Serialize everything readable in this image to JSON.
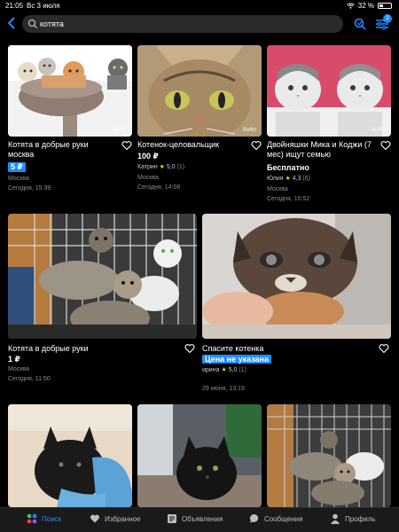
{
  "status_bar": {
    "time": "21:05",
    "date": "Вс 3 июля",
    "battery": "32 %"
  },
  "search": {
    "query": "котята"
  },
  "filter_badge_count": "2",
  "listings": [
    {
      "title": "Котята в добрые руки москва",
      "price": "5 ₽",
      "price_highlight": true,
      "seller": "",
      "rating": "",
      "reviews": "",
      "location": "Москва",
      "date": "Сегодня, 15:39",
      "watermark": "Avito"
    },
    {
      "title": "Котенок-целовальщик",
      "price": "100 ₽",
      "price_highlight": false,
      "seller": "Катрин",
      "rating": "5,0",
      "reviews": "(1)",
      "location": "Москва",
      "date": "Сегодня, 14:08",
      "watermark": "Avito"
    },
    {
      "title": "Двойняшки Мика и Коджи (7 мес) ищут семью",
      "price": "Бесплатно",
      "price_highlight": false,
      "seller": "Юлия",
      "rating": "4,3",
      "reviews": "(6)",
      "location": "Москва",
      "date": "Сегодня, 10:52",
      "watermark": "Avito"
    },
    {
      "title": "Котята в добрые руки",
      "price": "1 ₽",
      "price_highlight": false,
      "seller": "",
      "rating": "",
      "reviews": "",
      "location": "Москва",
      "date": "Сегодня, 11:50",
      "watermark": ""
    },
    {
      "title": "Спасите котенка",
      "price": "Цена не указана",
      "price_highlight": true,
      "seller": "ирина",
      "rating": "5,0",
      "reviews": "(1)",
      "location": "",
      "date": "29 июня, 13:19",
      "watermark": ""
    }
  ],
  "bottom_nav": [
    {
      "label": "Поиск",
      "icon": "search-dots-icon",
      "active": true
    },
    {
      "label": "Избранное",
      "icon": "heart-icon",
      "active": false
    },
    {
      "label": "Объявления",
      "icon": "listings-icon",
      "active": false
    },
    {
      "label": "Сообщения",
      "icon": "chat-icon",
      "active": false
    },
    {
      "label": "Профиль",
      "icon": "profile-icon",
      "active": false
    }
  ],
  "colors": {
    "accent": "#1e8cff",
    "background": "#000000",
    "star": "#ffc400"
  }
}
